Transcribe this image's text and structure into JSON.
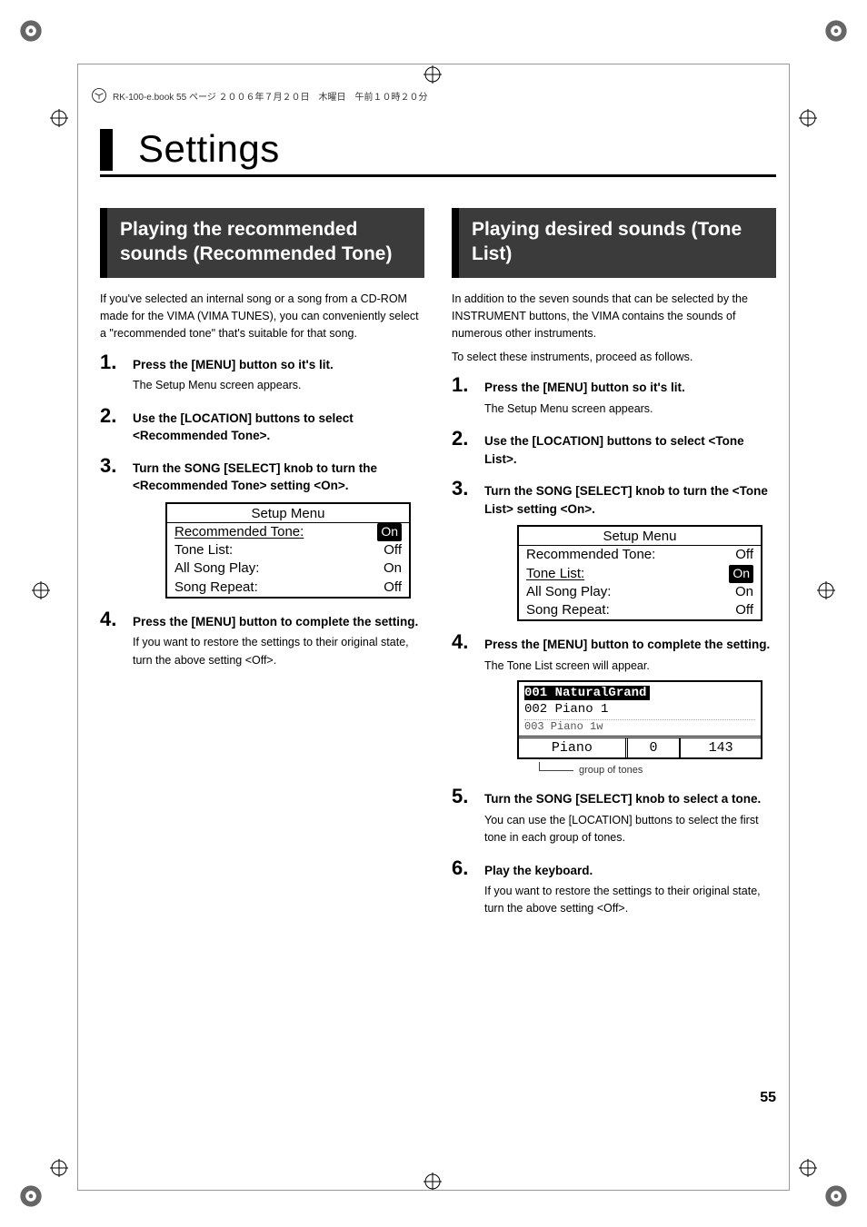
{
  "header_line": "RK-100-e.book  55 ページ  ２００６年７月２０日　木曜日　午前１０時２０分",
  "chapter_title": "Settings",
  "page_number": "55",
  "left": {
    "section_title": "Playing the recommended sounds (Recommended Tone)",
    "intro": "If you've selected an internal song or a song from a CD-ROM made for the VIMA (VIMA TUNES), you can conveniently select a \"recommended tone\" that's suitable for that song.",
    "steps": [
      {
        "head": "Press the [MENU] button so it's lit.",
        "body": "The Setup Menu screen appears."
      },
      {
        "head": "Use the [LOCATION] buttons to select <Recommended Tone>.",
        "body": ""
      },
      {
        "head": "Turn the SONG [SELECT] knob to turn the <Recommended Tone> setting <On>.",
        "body": ""
      },
      {
        "head": "Press the [MENU] button to complete the setting.",
        "body": "If you want to restore the settings to their original state, turn the above setting <Off>."
      }
    ],
    "lcd": {
      "title": "Setup Menu",
      "rows": [
        {
          "label": "Recommended Tone:",
          "value": "On",
          "label_ul": true,
          "val_boxed": true
        },
        {
          "label": "Tone List:",
          "value": "Off",
          "label_ul": false,
          "val_boxed": false
        },
        {
          "label": "All Song Play:",
          "value": "On",
          "label_ul": false,
          "val_boxed": false
        },
        {
          "label": "Song Repeat:",
          "value": "Off",
          "label_ul": false,
          "val_boxed": false
        }
      ]
    }
  },
  "right": {
    "section_title": "Playing desired sounds (Tone List)",
    "intro1": "In addition to the seven sounds that can be selected by the INSTRUMENT buttons, the VIMA contains the sounds of numerous other instruments.",
    "intro2": "To select these instruments, proceed as follows.",
    "steps": [
      {
        "head": "Press the [MENU] button so it's lit.",
        "body": "The Setup Menu screen appears."
      },
      {
        "head": "Use the [LOCATION] buttons to select <Tone List>.",
        "body": ""
      },
      {
        "head": "Turn the SONG [SELECT] knob to turn the <Tone List> setting <On>.",
        "body": ""
      },
      {
        "head": "Press the [MENU] button to complete the setting.",
        "body": "The Tone List screen will appear."
      },
      {
        "head": "Turn the SONG [SELECT] knob to select a tone.",
        "body": "You can use the [LOCATION] buttons to select the first tone in each group of tones."
      },
      {
        "head": "Play the keyboard.",
        "body": "If you want to restore the settings to their original state, turn the above setting <Off>."
      }
    ],
    "lcd": {
      "title": "Setup Menu",
      "rows": [
        {
          "label": "Recommended Tone:",
          "value": "Off",
          "label_ul": false,
          "val_boxed": false
        },
        {
          "label": "Tone List:",
          "value": "On",
          "label_ul": true,
          "val_boxed": true
        },
        {
          "label": "All Song Play:",
          "value": "On",
          "label_ul": false,
          "val_boxed": false
        },
        {
          "label": "Song Repeat:",
          "value": "Off",
          "label_ul": false,
          "val_boxed": false
        }
      ]
    },
    "tone_lcd": {
      "rows": [
        "001  NaturalGrand",
        "002  Piano 1",
        "003  Piano 1w"
      ],
      "group": "Piano",
      "page": "0",
      "num": "143"
    },
    "caption": "group of tones"
  }
}
